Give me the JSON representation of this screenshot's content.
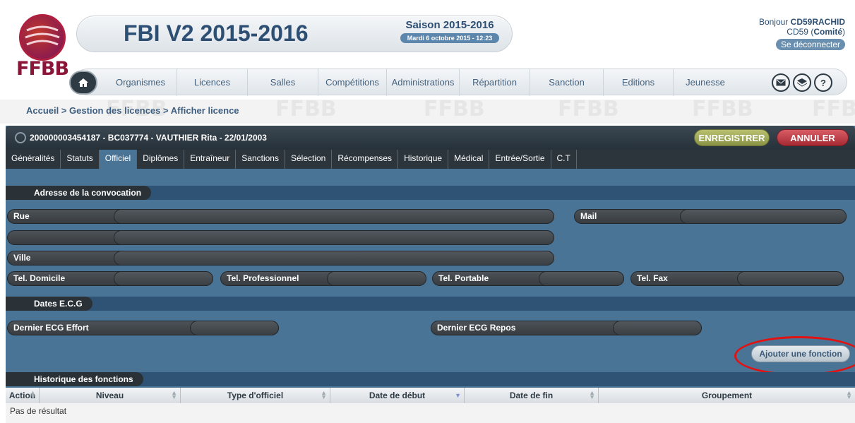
{
  "header": {
    "logo_text": "FFBB",
    "app_title": "FBI V2 2015-2016",
    "season_title": "Saison 2015-2016",
    "season_date": "Mardi 6 octobre 2015 - 12:23",
    "greeting": "Bonjour",
    "username": "CD59RACHID",
    "org": "CD59",
    "org_type": "Comité",
    "logout_label": "Se déconnecter"
  },
  "nav": {
    "items": [
      "Organismes",
      "Licences",
      "Salles",
      "Compétitions",
      "Administrations",
      "Répartition",
      "Sanction",
      "Editions",
      "Jeunesse"
    ]
  },
  "breadcrumb": "Accueil > Gestion des licences > Afficher licence",
  "panel": {
    "record": "200000003454187 - BC037774 - VAUTHIER Rita - 22/01/2003",
    "save_label": "ENREGISTRER",
    "cancel_label": "ANNULER",
    "tabs": [
      "Généralités",
      "Statuts",
      "Officiel",
      "Diplômes",
      "Entraîneur",
      "Sanctions",
      "Sélection",
      "Récompenses",
      "Historique",
      "Médical",
      "Entrée/Sortie",
      "C.T"
    ],
    "active_tab": "Officiel"
  },
  "address_section": {
    "title": "Adresse de la convocation",
    "rue_label": "Rue",
    "mail_label": "Mail",
    "ville_label": "Ville",
    "tel_domicile": "Tel. Domicile",
    "tel_pro": "Tel. Professionnel",
    "tel_portable": "Tel. Portable",
    "tel_fax": "Tel. Fax"
  },
  "ecg_section": {
    "title": "Dates E.C.G",
    "effort_label": "Dernier ECG Effort",
    "repos_label": "Dernier ECG Repos"
  },
  "add_function_label": "Ajouter une fonction",
  "history_section": {
    "title": "Historique des fonctions",
    "columns": [
      "Action",
      "Niveau",
      "Type d'officiel",
      "Date de début",
      "Date de fin",
      "Groupement"
    ],
    "empty_text": "Pas de résultat"
  },
  "colors": {
    "panel": "#4a7496",
    "dark_bar": "#2c353c",
    "save": "#9aa24e",
    "cancel": "#b8333c",
    "highlight": "#e31212"
  }
}
